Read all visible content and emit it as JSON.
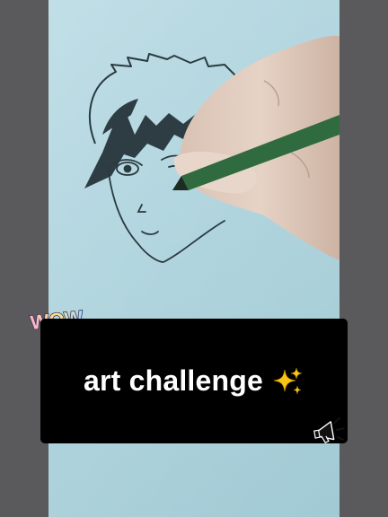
{
  "caption": {
    "text": "art challenge",
    "emoji_icon": "sparkles-icon"
  },
  "sticker": {
    "text": "WOW"
  },
  "decorations": {
    "megaphone_icon": "megaphone-icon"
  },
  "colors": {
    "paper": "#b2d6e0",
    "caption_bg": "#000000",
    "caption_text": "#ffffff",
    "pillarbox": "#5a5a5c",
    "sparkle": "#f5c518"
  }
}
